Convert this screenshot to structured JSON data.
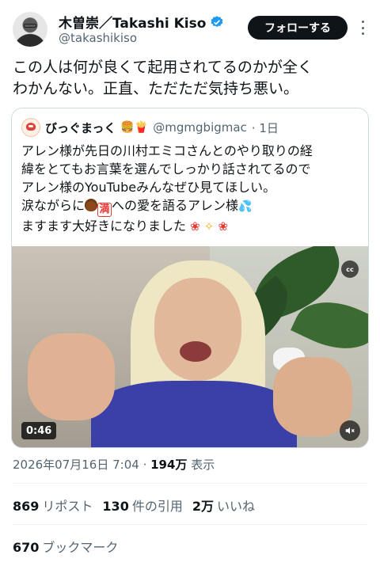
{
  "author": {
    "display_name": "木曽崇／Takashi Kiso",
    "handle": "@takashikiso",
    "verified": true,
    "follow_label": "フォローする"
  },
  "tweet": {
    "text_line1": "この人は何が良くて起用されてるのかが全く",
    "text_line2": "わかんない。正直、ただただ気持ち悪い。"
  },
  "quoted": {
    "display_name": "びっぐまっく",
    "name_emojis": "🍔🍟",
    "handle": "@mgmgbigmac",
    "time": "· 1日",
    "line1": "アレン様が先日の川村エミコさんとのやり取りの経",
    "line2": "緯をとてもお言葉を選んでしっかり話されてるので",
    "line3": "アレン様のYouTubeみんなぜひ見てほしい。",
    "line4_pre": "涙ながらに",
    "line4_man": "満",
    "line4_post": "への愛を語るアレン様",
    "line5": "ますます大好きになりました",
    "video": {
      "duration": "0:46",
      "cc_label": "cc"
    }
  },
  "meta": {
    "datetime": "2026年07月16日 7:04 · ",
    "views": "194万",
    "views_label": " 表示"
  },
  "stats": {
    "reposts_count": "869",
    "reposts_label": "リポスト",
    "quotes_count": "130",
    "quotes_label": "件の引用",
    "likes_count": "2万",
    "likes_label": "いいね",
    "bookmarks_count": "670",
    "bookmarks_label": "ブックマーク"
  },
  "colors": {
    "verified": "#1d9bf0",
    "text_primary": "#0f1419",
    "text_secondary": "#536471",
    "follow_bg": "#0f1419",
    "border": "#cfd9de"
  },
  "icons": [
    "verified-badge-icon",
    "more-icon",
    "cc-icon",
    "mute-icon"
  ]
}
